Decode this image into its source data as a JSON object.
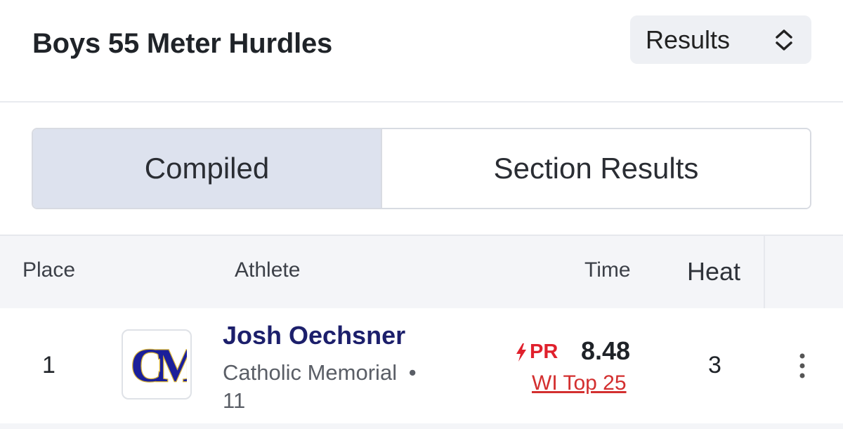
{
  "event": {
    "title": "Boys 55 Meter Hurdles"
  },
  "view_select": {
    "value": "Results",
    "icon": "chevron-up-down-icon"
  },
  "tabs": [
    {
      "label": "Compiled",
      "active": true
    },
    {
      "label": "Section Results",
      "active": false
    }
  ],
  "table": {
    "headers": {
      "place": "Place",
      "athlete": "Athlete",
      "time": "Time",
      "heat": "Heat"
    },
    "rows": [
      {
        "place": "1",
        "logo_text": "CM",
        "athlete": "Josh Oechsner",
        "team": "Catholic Memorial",
        "separator": "•",
        "grade": "11",
        "pr_badge": "PR",
        "mark": "8.48",
        "ranking": "WI Top 25",
        "heat": "3"
      }
    ]
  },
  "colors": {
    "accent": "#1c1f6b",
    "pr": "#e0202c",
    "active_tab": "#dde2ee",
    "header_bg": "#f4f5f8"
  }
}
